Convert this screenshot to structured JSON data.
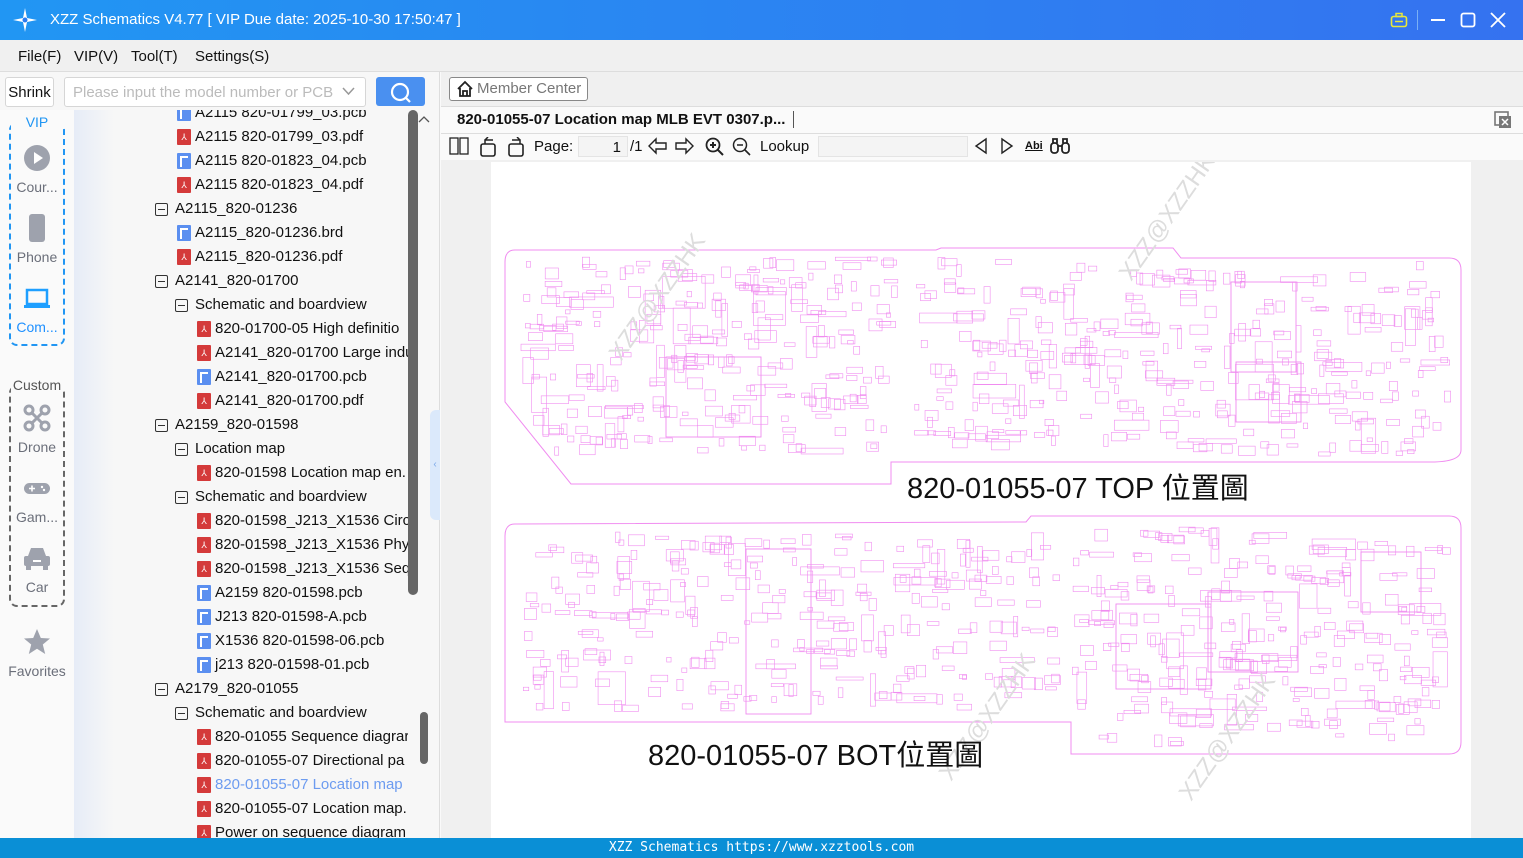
{
  "app": {
    "title": "XZZ Schematics V4.77 [ VIP Due date: 2025-10-30 17:50:47 ]"
  },
  "menu": [
    "File(F)",
    "VIP(V)",
    "Tool(T)",
    "Settings(S)"
  ],
  "search": {
    "shrink_label": "Shrink",
    "placeholder": "Please input the model number or PCB"
  },
  "rail": {
    "vip_label": "VIP",
    "custom_label": "Custom",
    "items": [
      {
        "label": "Cour...",
        "icon": "play-icon"
      },
      {
        "label": "Phone",
        "icon": "phone-icon"
      },
      {
        "label": "Com...",
        "icon": "laptop-icon",
        "active": true
      },
      {
        "label": "Drone",
        "icon": "drone-icon"
      },
      {
        "label": "Gam...",
        "icon": "gamepad-icon"
      },
      {
        "label": "Car",
        "icon": "car-icon"
      },
      {
        "label": "Favorites",
        "icon": "star-icon"
      }
    ],
    "colors": {
      "vip": "#2196f3",
      "active": "#1e90ff",
      "inactive": "#6b6f7a"
    }
  },
  "tree": [
    {
      "level": 1,
      "type": "pcb",
      "label": "A2115 820-01799_03.pcb"
    },
    {
      "level": 1,
      "type": "pdf",
      "label": "A2115 820-01799_03.pdf"
    },
    {
      "level": 1,
      "type": "pcb",
      "label": "A2115 820-01823_04.pcb"
    },
    {
      "level": 1,
      "type": "pdf",
      "label": "A2115 820-01823_04.pdf"
    },
    {
      "level": 0,
      "type": "group",
      "label": "A2115_820-01236"
    },
    {
      "level": 1,
      "type": "pcb",
      "label": "A2115_820-01236.brd"
    },
    {
      "level": 1,
      "type": "pdf",
      "label": "A2115_820-01236.pdf"
    },
    {
      "level": 0,
      "type": "group",
      "label": "A2141_820-01700"
    },
    {
      "level": 1,
      "type": "group",
      "label": "Schematic and boardview"
    },
    {
      "level": 2,
      "type": "pdf",
      "label": "820-01700-05 High definitio"
    },
    {
      "level": 2,
      "type": "pdf",
      "label": "A2141_820-01700 Large indu"
    },
    {
      "level": 2,
      "type": "pcb",
      "label": "A2141_820-01700.pcb"
    },
    {
      "level": 2,
      "type": "pdf",
      "label": "A2141_820-01700.pdf"
    },
    {
      "level": 0,
      "type": "group",
      "label": "A2159_820-01598"
    },
    {
      "level": 1,
      "type": "group",
      "label": "Location map"
    },
    {
      "level": 2,
      "type": "pdf",
      "label": "820-01598 Location map en."
    },
    {
      "level": 1,
      "type": "group",
      "label": "Schematic and boardview"
    },
    {
      "level": 2,
      "type": "pdf",
      "label": "820-01598_J213_X1536 Circu"
    },
    {
      "level": 2,
      "type": "pdf",
      "label": "820-01598_J213_X1536 Physi"
    },
    {
      "level": 2,
      "type": "pdf",
      "label": "820-01598_J213_X1536 Sequ"
    },
    {
      "level": 2,
      "type": "pcb",
      "label": "A2159 820-01598.pcb"
    },
    {
      "level": 2,
      "type": "pcb",
      "label": "J213 820-01598-A.pcb"
    },
    {
      "level": 2,
      "type": "pcb",
      "label": "X1536 820-01598-06.pcb"
    },
    {
      "level": 2,
      "type": "pcb",
      "label": "j213 820-01598-01.pcb"
    },
    {
      "level": 0,
      "type": "group",
      "label": "A2179_820-01055"
    },
    {
      "level": 1,
      "type": "group",
      "label": "Schematic and boardview"
    },
    {
      "level": 2,
      "type": "pdf",
      "label": "820-01055 Sequence diagrar"
    },
    {
      "level": 2,
      "type": "pdf",
      "label": "820-01055-07 Directional pa"
    },
    {
      "level": 2,
      "type": "pdf",
      "label": "820-01055-07 Location map",
      "selected": true
    },
    {
      "level": 2,
      "type": "pdf",
      "label": "820-01055-07 Location map."
    },
    {
      "level": 2,
      "type": "pdf",
      "label": "Power on sequence diagram"
    }
  ],
  "viewer": {
    "member_center": "Member Center",
    "tab_title": "820-01055-07 Location map MLB EVT 0307.p...",
    "page_label": "Page:",
    "page_value": "1",
    "page_total": "/1",
    "lookup_label": "Lookup",
    "lookup_value": "",
    "abi_label": "Abi",
    "top_label": "820-01055-07   TOP 位置圖",
    "bot_label": "820-01055-07   BOT位置圖",
    "watermark": "XZZ@XZZHK",
    "board_color": "#f08cf0"
  },
  "status": "XZZ Schematics https://www.xzztools.com"
}
